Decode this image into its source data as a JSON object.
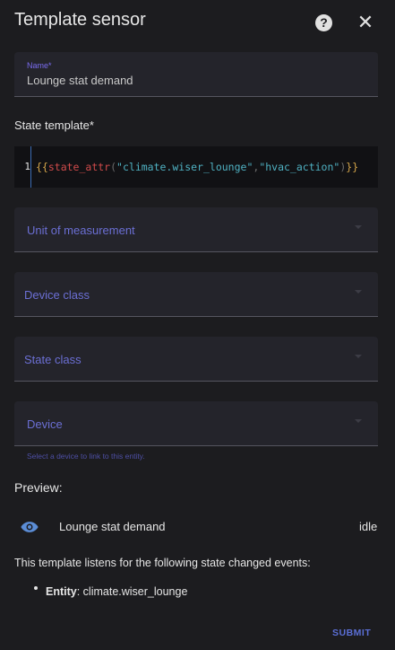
{
  "dialog": {
    "title": "Template sensor",
    "help_icon": "help-circle-icon",
    "close_icon": "close-icon"
  },
  "name_field": {
    "label": "Name*",
    "value": "Lounge stat demand"
  },
  "state_template": {
    "label": "State template*",
    "line_number": "1",
    "code_open": "{{",
    "code_fn": "state_attr",
    "code_paren_open": "(",
    "code_arg1": "\"climate.wiser_lounge\"",
    "code_comma": ",",
    "code_arg2": "\"hvac_action\"",
    "code_paren_close": ")",
    "code_close": "}}"
  },
  "selects": {
    "unit": "Unit of measurement",
    "device_class": "Device class",
    "state_class": "State class",
    "device": "Device",
    "device_helper": "Select a device to link to this entity."
  },
  "preview": {
    "label": "Preview:",
    "icon": "eye-icon",
    "entity_name": "Lounge stat demand",
    "entity_state": "idle",
    "listens_text": "This template listens for the following state changed events:",
    "event_type": "Entity",
    "event_value": ": climate.wiser_lounge"
  },
  "actions": {
    "submit": "SUBMIT"
  },
  "colors": {
    "accent": "#5b6fd6",
    "background": "#1c1c1f",
    "field_bg": "#24242b"
  }
}
